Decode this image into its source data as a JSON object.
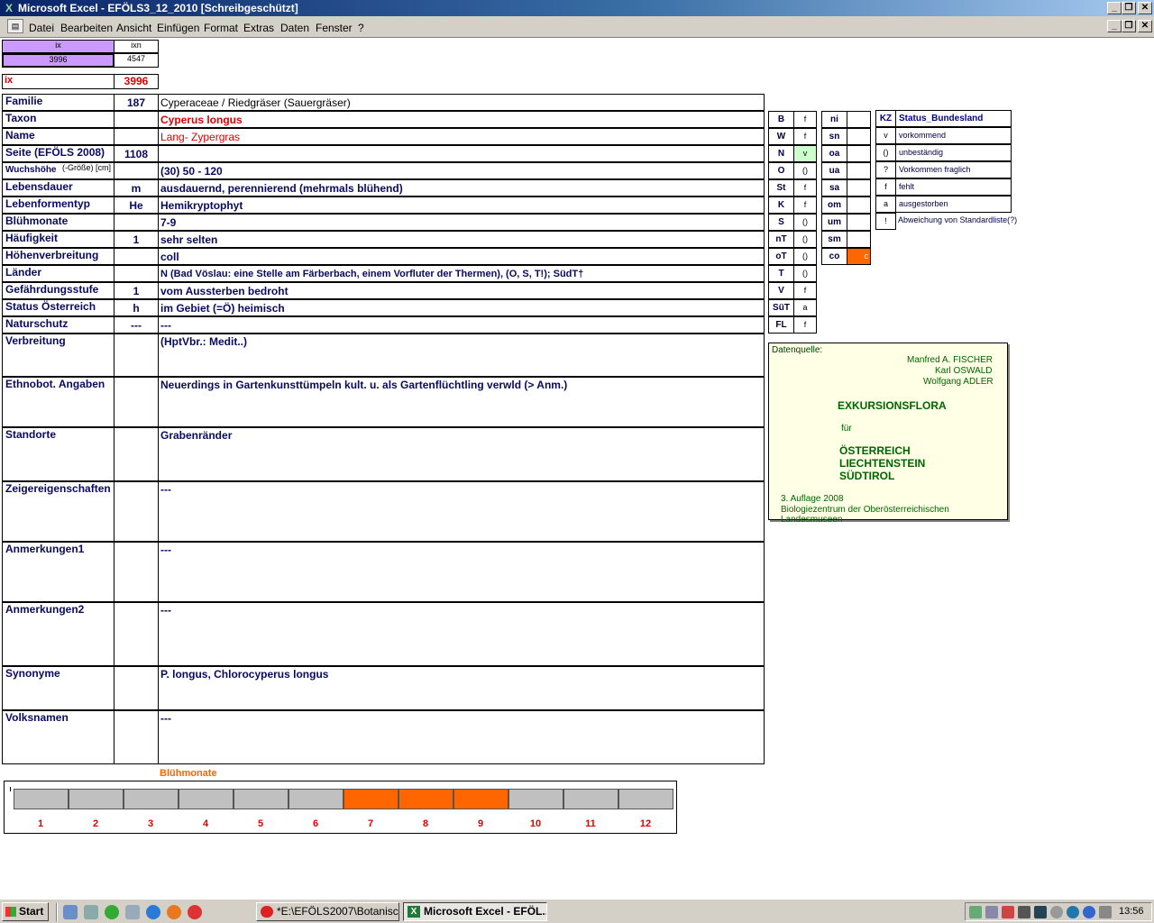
{
  "window": {
    "title": "Microsoft Excel - EFÖLS3_12_2010  [Schreibgeschützt]"
  },
  "menu": [
    "Datei",
    "Bearbeiten",
    "Ansicht",
    "Einfügen",
    "Format",
    "Extras",
    "Daten",
    "Fenster",
    "?"
  ],
  "header_cells": {
    "ix_label": "ix",
    "ixn_label": "ixn",
    "ix_value": "3996",
    "ixn_value": "4547",
    "ix_row_label": "ix",
    "ix_row_value": "3996"
  },
  "rows": [
    {
      "label": "Familie",
      "code": "187",
      "value": "Cyperaceae  /  Riedgräser (Sauergräser)"
    },
    {
      "label": "Taxon",
      "code": "",
      "value": "Cyperus longus"
    },
    {
      "label": "Name",
      "code": "",
      "value": "Lang- Zypergras"
    },
    {
      "label": "Seite (EFÖLS 2008)",
      "code": "1108",
      "value": ""
    },
    {
      "label": "Wuchshöhe",
      "label_small": "(-Größe) [cm]",
      "code": "",
      "value": " (30) 50 - 120"
    },
    {
      "label": "Lebensdauer",
      "code": "m",
      "value": "ausdauernd, perennierend (mehrmals blühend)"
    },
    {
      "label": "Lebenformentyp",
      "code": "He",
      "value": "Hemikryptophyt"
    },
    {
      "label": "Blühmonate",
      "code": "",
      "value": " 7-9"
    },
    {
      "label": "Häufigkeit",
      "code": "1",
      "value": "sehr selten"
    },
    {
      "label": "Höhenverbreitung",
      "code": "",
      "value": "coll"
    },
    {
      "label": "Länder",
      "code": "",
      "value": "N (Bad Vöslau: eine Stelle am Färberbach, einem Vorfluter der Thermen), (O, S, T!); SüdT†"
    },
    {
      "label": "Gefährdungsstufe",
      "code": "1",
      "value": "vom Aussterben bedroht"
    },
    {
      "label": "Status Österreich",
      "code": "h",
      "value": "im Gebiet (=Ö) heimisch"
    },
    {
      "label": "Naturschutz",
      "code": "---",
      "value": " ---"
    },
    {
      "label": "Verbreitung",
      "code": "",
      "value": " (HptVbr.: Medit..)"
    },
    {
      "label": "Ethnobot. Angaben",
      "code": "",
      "value": "Neuerdings in Gartenkunsttümpeln kult. u. als Gartenflüchtling verwld (> Anm.)"
    },
    {
      "label": "Standorte",
      "code": "",
      "value": "Grabenränder"
    },
    {
      "label": "Zeigereigenschaften",
      "code": "",
      "value": "---"
    },
    {
      "label": "Anmerkungen1",
      "code": "",
      "value": "---"
    },
    {
      "label": "Anmerkungen2",
      "code": "",
      "value": "---"
    },
    {
      "label": "Synonyme",
      "code": "",
      "value": "P. longus, Chlorocyperus longus"
    },
    {
      "label": "Volksnamen",
      "code": "",
      "value": "---"
    }
  ],
  "states": [
    {
      "code": "B",
      "status": "f"
    },
    {
      "code": "W",
      "status": "f"
    },
    {
      "code": "N",
      "status": "v"
    },
    {
      "code": "O",
      "status": "()"
    },
    {
      "code": "St",
      "status": "f"
    },
    {
      "code": "K",
      "status": "f"
    },
    {
      "code": "S",
      "status": "()"
    },
    {
      "code": "nT",
      "status": "()"
    },
    {
      "code": "oT",
      "status": "()"
    },
    {
      "code": "T",
      "status": "()"
    },
    {
      "code": "V",
      "status": "f"
    },
    {
      "code": "SüT",
      "status": "a"
    },
    {
      "code": "FL",
      "status": "f"
    }
  ],
  "altitude_zones": [
    {
      "code": "ni",
      "mark": ""
    },
    {
      "code": "sn",
      "mark": ""
    },
    {
      "code": "oa",
      "mark": ""
    },
    {
      "code": "ua",
      "mark": ""
    },
    {
      "code": "sa",
      "mark": ""
    },
    {
      "code": "om",
      "mark": ""
    },
    {
      "code": "um",
      "mark": ""
    },
    {
      "code": "sm",
      "mark": ""
    },
    {
      "code": "co",
      "mark": "c"
    }
  ],
  "legend": {
    "header_kz": "KZ",
    "header_status": "Status_Bundesland",
    "items": [
      {
        "kz": "v",
        "text": "vorkommend"
      },
      {
        "kz": "()",
        "text": "unbeständig"
      },
      {
        "kz": "?",
        "text": "Vorkommen fraglich"
      },
      {
        "kz": "f",
        "text": "fehlt"
      },
      {
        "kz": "a",
        "text": "ausgestorben"
      },
      {
        "kz": "!",
        "text": "Abweichung von Standardliste(?)"
      }
    ]
  },
  "datasource": {
    "label": "Datenquelle:",
    "authors": [
      "Manfred A. FISCHER",
      "Karl OSWALD",
      "Wolfgang ADLER"
    ],
    "title": "EXKURSIONSFLORA",
    "fuer": "für",
    "regions": [
      "ÖSTERREICH",
      "LIECHTENSTEIN",
      "SÜDTIROL"
    ],
    "edition": "3. Auflage 2008",
    "publisher": "Biologiezentrum der Oberösterreichischen Landesmuseen"
  },
  "bloom_chart": {
    "title": "Blühmonate",
    "months": [
      "1",
      "2",
      "3",
      "4",
      "5",
      "6",
      "7",
      "8",
      "9",
      "10",
      "11",
      "12"
    ],
    "active": [
      false,
      false,
      false,
      false,
      false,
      false,
      true,
      true,
      true,
      false,
      false,
      false
    ],
    "colors": {
      "active": "#ff6600",
      "inactive": "#c0c0c0"
    }
  },
  "taskbar": {
    "start": "Start",
    "tasks": [
      "*E:\\EFÖLS2007\\Botanisc...",
      "Microsoft Excel - EFÖL..."
    ],
    "clock": "13:56"
  }
}
